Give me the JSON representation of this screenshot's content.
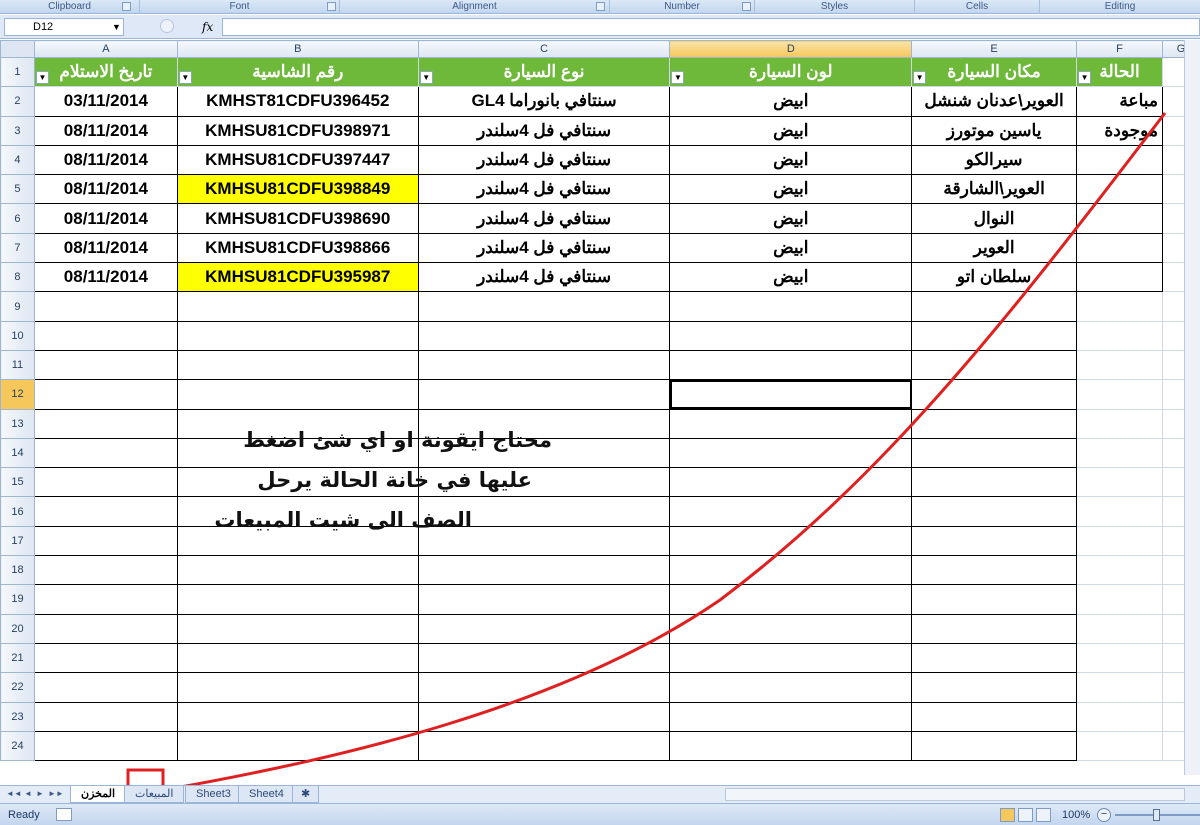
{
  "ribbon": {
    "groups": [
      "Clipboard",
      "Font",
      "Alignment",
      "Number",
      "Styles",
      "Cells",
      "Editing"
    ]
  },
  "formula_bar": {
    "name_box": "D12",
    "fx": "fx",
    "value": ""
  },
  "columns": [
    "A",
    "B",
    "C",
    "D",
    "E",
    "F",
    "G"
  ],
  "rows": [
    "1",
    "2",
    "3",
    "4",
    "5",
    "6",
    "7",
    "8",
    "9",
    "10",
    "11",
    "12",
    "13",
    "14",
    "15",
    "16",
    "17",
    "18",
    "19",
    "20",
    "21",
    "22",
    "23",
    "24"
  ],
  "header_row": [
    "تاريخ الاستلام",
    "رقم الشاسية",
    "نوع السيارة",
    "لون السيارة",
    "مكان السيارة",
    "الحالة"
  ],
  "data_rows": [
    {
      "date": "03/11/2014",
      "chassis": "KMHST81CDFU396452",
      "type": "سنتافي بانوراما GL4",
      "color": "ابيض",
      "location": "العوير\\عدنان شنشل",
      "status": "مباعة"
    },
    {
      "date": "08/11/2014",
      "chassis": "KMHSU81CDFU398971",
      "type": "سنتافي فل 4سلندر",
      "color": "ابيض",
      "location": "ياسين موتورز",
      "status": "موجودة"
    },
    {
      "date": "08/11/2014",
      "chassis": "KMHSU81CDFU397447",
      "type": "سنتافي فل 4سلندر",
      "color": "ابيض",
      "location": "سيرالكو",
      "status": ""
    },
    {
      "date": "08/11/2014",
      "chassis": "KMHSU81CDFU398849",
      "type": "سنتافي فل 4سلندر",
      "color": "ابيض",
      "location": "العوير\\الشارقة",
      "status": ""
    },
    {
      "date": "08/11/2014",
      "chassis": "KMHSU81CDFU398690",
      "type": "سنتافي فل 4سلندر",
      "color": "ابيض",
      "location": "النوال",
      "status": ""
    },
    {
      "date": "08/11/2014",
      "chassis": "KMHSU81CDFU398866",
      "type": "سنتافي فل 4سلندر",
      "color": "ابيض",
      "location": "العوير",
      "status": ""
    },
    {
      "date": "08/11/2014",
      "chassis": "KMHSU81CDFU395987",
      "type": "سنتافي فل 4سلندر",
      "color": "ابيض",
      "location": "سلطان اتو",
      "status": ""
    }
  ],
  "highlight_color": "#ffff00",
  "header_color": "#6eb83a",
  "annotation": {
    "lines": [
      "محتاج ايقونة او اي شئ اضغط",
      "عليها في خانة الحالة يرحل",
      "الصف الى شيت المبيعات"
    ],
    "arrow_color": "#e02020"
  },
  "sheet_tabs": {
    "nav": [
      "◄◄",
      "◄",
      "►",
      "►►"
    ],
    "tabs": [
      "المخزن",
      "المبيعات",
      "Sheet3",
      "Sheet4"
    ],
    "active": "المخزن"
  },
  "status_bar": {
    "mode": "Ready",
    "zoom": "100%",
    "zoom_minus": "−"
  }
}
